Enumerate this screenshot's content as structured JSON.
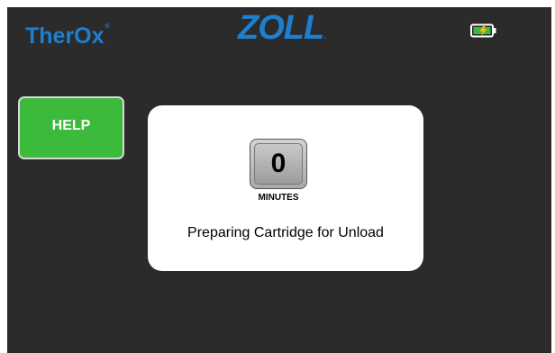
{
  "header": {
    "brand_left": "TherOx",
    "brand_left_mark": "®",
    "brand_center": "ZOLL",
    "brand_center_mark": "."
  },
  "battery": {
    "icon": "battery-charging-icon",
    "body_color": "#3cba3c",
    "bolt_color": "#f5c518"
  },
  "help_button": {
    "label": "HELP",
    "color": "#3cba3c"
  },
  "timer": {
    "value": "0",
    "unit_label": "MINUTES"
  },
  "status": {
    "message": "Preparing Cartridge for Unload"
  },
  "colors": {
    "background": "#2b2b2b",
    "brand": "#1e7fd0"
  }
}
